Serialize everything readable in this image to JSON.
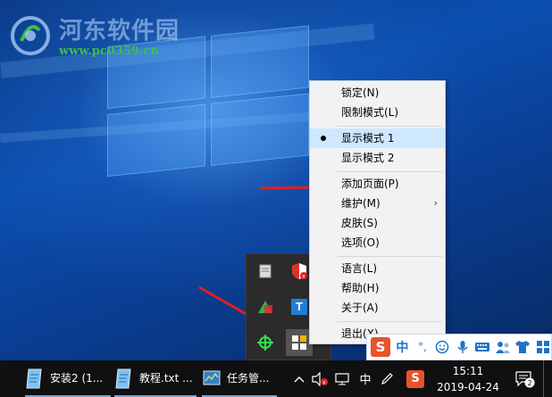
{
  "watermark": {
    "title": "河东软件园",
    "url": "www.pc0359.cn"
  },
  "context_menu": {
    "items": [
      {
        "label": "锁定(N)",
        "checked": false,
        "submenu": false
      },
      {
        "label": "限制模式(L)",
        "checked": false,
        "submenu": false
      },
      {
        "label": "显示模式 1",
        "checked": true,
        "submenu": false
      },
      {
        "label": "显示模式 2",
        "checked": false,
        "submenu": false
      },
      {
        "label": "添加页面(P)",
        "checked": false,
        "submenu": false
      },
      {
        "label": "维护(M)",
        "checked": false,
        "submenu": true
      },
      {
        "label": "皮肤(S)",
        "checked": false,
        "submenu": false
      },
      {
        "label": "选项(O)",
        "checked": false,
        "submenu": false
      },
      {
        "label": "语言(L)",
        "checked": false,
        "submenu": false
      },
      {
        "label": "帮助(H)",
        "checked": false,
        "submenu": false
      },
      {
        "label": "关于(A)",
        "checked": false,
        "submenu": false
      },
      {
        "label": "退出(X)",
        "checked": false,
        "submenu": false
      }
    ],
    "submenu_arrow": "›"
  },
  "tray_overflow": {
    "icons": [
      "app-square-icon",
      "security-shield-icon",
      "green-triangle-icon",
      "text-t-icon",
      "crosshair-icon",
      "tiles-app-icon"
    ],
    "text_icon_label": "T"
  },
  "ime_bar": {
    "logo": "S",
    "mode": "中",
    "punct": "°,",
    "icons": [
      "smiley-icon",
      "microphone-icon",
      "keyboard-icon",
      "users-icon",
      "shirt-icon",
      "grid-icon"
    ]
  },
  "taskbar": {
    "tasks": [
      {
        "label": "安装2 (1...",
        "icon": "notepad-icon"
      },
      {
        "label": "教程.txt ...",
        "icon": "notepad-icon"
      },
      {
        "label": "任务管...",
        "icon": "task-manager-icon"
      }
    ],
    "tray": {
      "ime_indicator": "中",
      "sogou_logo": "S"
    },
    "clock": {
      "time": "15:11",
      "date": "2019-04-24"
    },
    "notification_count": "2"
  },
  "colors": {
    "menu_bg": "#f2f2f2",
    "menu_checked_bg": "#cde8ff",
    "taskbar_bg": "#101010",
    "arrow_red": "#e02020",
    "sogou_orange": "#e8522b"
  }
}
